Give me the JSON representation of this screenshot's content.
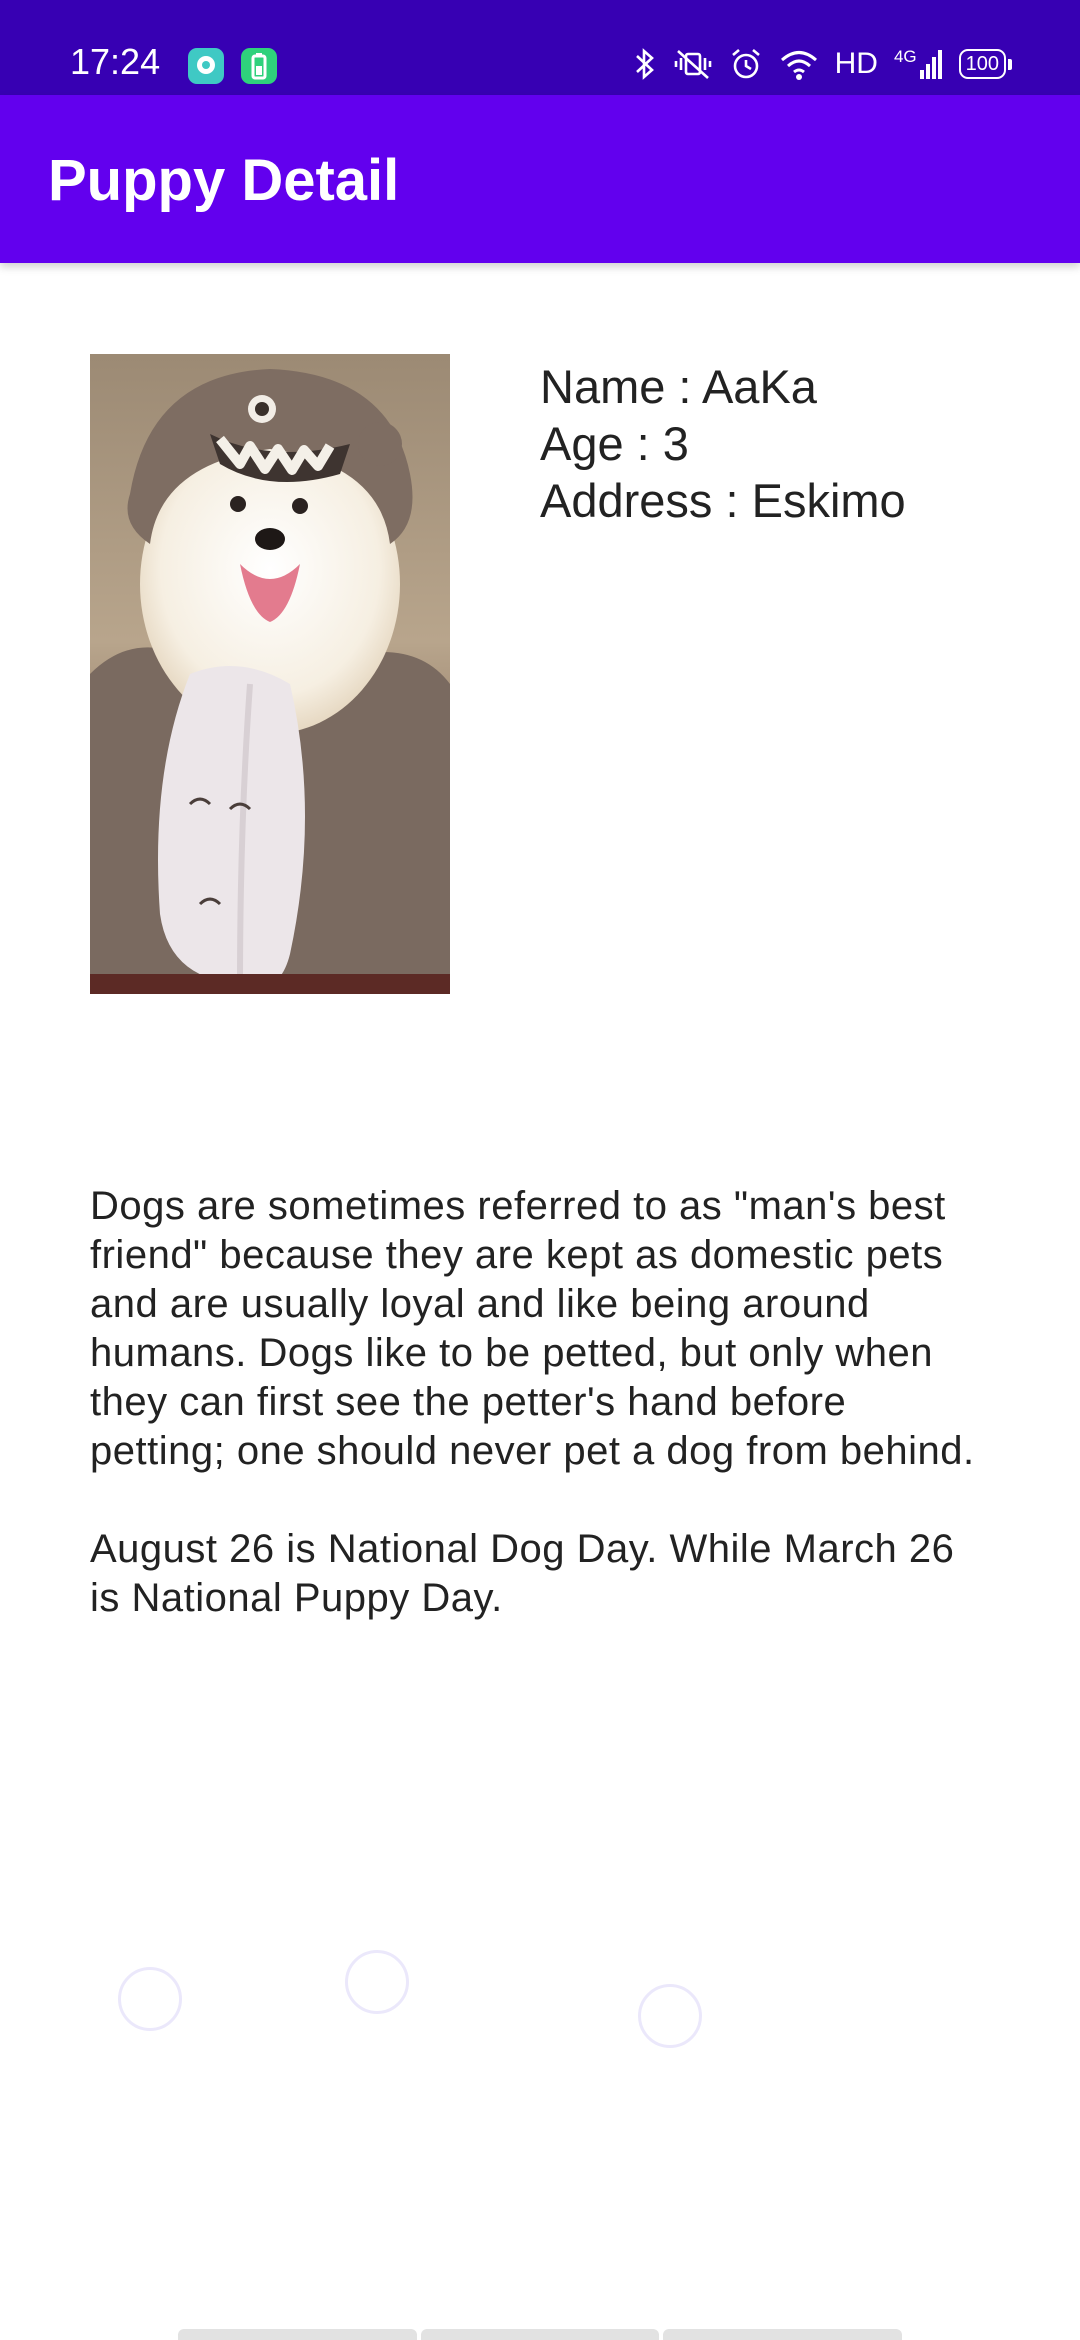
{
  "status_bar": {
    "time": "17:24",
    "icons": [
      "chat-notification-icon",
      "battery-saver-notification-icon",
      "bluetooth-icon",
      "vibrate-icon",
      "alarm-icon",
      "wifi-icon",
      "cellular-signal-icon",
      "battery-icon"
    ],
    "hd_label": "HD",
    "network_label": "4G",
    "battery_level": "100"
  },
  "app_bar": {
    "title": "Puppy Detail",
    "background": "#6200ee",
    "status_background": "#3700b3"
  },
  "puppy": {
    "image": "dog-photo",
    "name_line": "Name : AaKa",
    "age_line": "Age : 3",
    "address_line": "Address : Eskimo"
  },
  "description": {
    "paragraph_1": "Dogs are sometimes referred to as \"man's best friend\" because they are kept as domestic pets and are usually loyal and like being around humans. Dogs like to be petted, but only when they can first see the petter's hand before petting; one should never pet a dog from behind.",
    "paragraph_2": "August 26 is National Dog Day. While March 26 is National Puppy Day."
  }
}
